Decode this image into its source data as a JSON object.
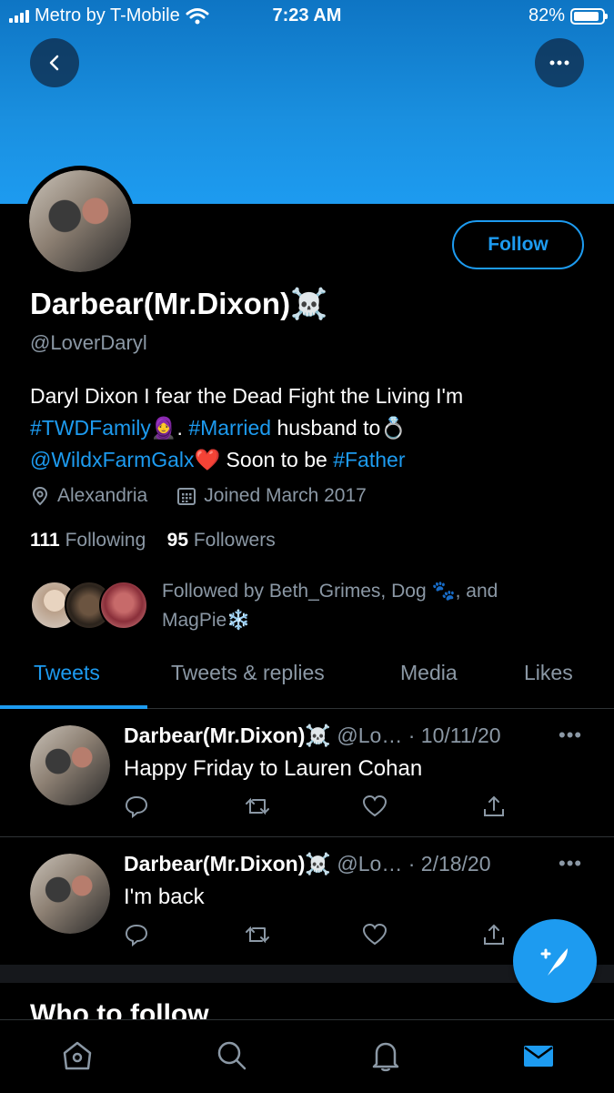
{
  "status_bar": {
    "carrier": "Metro by T-Mobile",
    "time": "7:23 AM",
    "battery": "82%",
    "battery_level": 0.82
  },
  "profile": {
    "follow_label": "Follow",
    "name": "Darbear(Mr.Dixon)☠️",
    "handle": "@LoverDaryl",
    "bio": {
      "line1": "Daryl Dixon I fear the Dead Fight the Living I'm",
      "tag_twdfamily": "#TWDFamily🧕",
      "sep": ". ",
      "tag_married": "#Married",
      "husband_to": " husband to💍",
      "mention": "@WildxFarmGalx",
      "heart": "❤️",
      "soon": " Soon to be ",
      "tag_father": "#Father"
    },
    "location": "Alexandria",
    "joined": "Joined March 2017",
    "following_count": "111",
    "following_label": "Following",
    "followers_count": "95",
    "followers_label": "Followers",
    "followed_by": "Followed by Beth_Grimes, Dog 🐾, and MagPie❄️"
  },
  "tabs": [
    "Tweets",
    "Tweets & replies",
    "Media",
    "Likes"
  ],
  "tweets": [
    {
      "name": "Darbear(Mr.Dixon)☠️",
      "handle_date": "@Lo… · 10/11/20",
      "text": "Happy Friday to Lauren Cohan"
    },
    {
      "name": "Darbear(Mr.Dixon)☠️",
      "handle_date": "@Lo… · 2/18/20",
      "text": "I'm back"
    }
  ],
  "who_to_follow": "Who to follow",
  "icons": {
    "back": "chevron-left-icon",
    "more": "more-icon",
    "location": "location-pin-icon",
    "calendar": "calendar-icon",
    "reply": "reply-icon",
    "retweet": "retweet-icon",
    "like": "heart-icon",
    "share": "share-icon",
    "home": "home-icon",
    "search": "search-icon",
    "notifications": "bell-icon",
    "messages": "mail-icon",
    "compose": "compose-icon"
  },
  "colors": {
    "accent": "#1d9bf0",
    "muted": "#8b98a5",
    "background": "#000000"
  }
}
